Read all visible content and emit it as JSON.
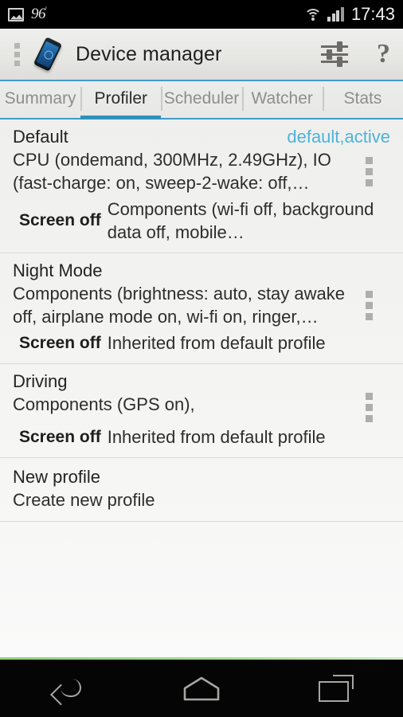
{
  "statusbar": {
    "gallery_icon": "gallery-icon",
    "battery_text": "96",
    "battery_mark": "'",
    "wifi_icon": "wifi-icon",
    "signal_icon": "signal-bars-icon",
    "time": "17:43"
  },
  "actionbar": {
    "overflow_icon": "grid-dots-icon",
    "app_icon": "device-phone-icon",
    "title": "Device manager",
    "settings_icon": "sliders-icon",
    "help_icon": "question-mark-icon",
    "help_label": "?"
  },
  "tabs": [
    {
      "label": "Summary",
      "active": false
    },
    {
      "label": "Profiler",
      "active": true
    },
    {
      "label": "Scheduler",
      "active": false
    },
    {
      "label": "Watcher",
      "active": false
    },
    {
      "label": "Stats",
      "active": false
    }
  ],
  "colors": {
    "accent_blue": "#2f92bc",
    "state_blue": "#4eb3d8",
    "divider": "#dadad8",
    "green_line": "#8fd07a"
  },
  "profiles": [
    {
      "name": "Default",
      "state": "default,active",
      "description": "CPU (ondemand, 300MHz, 2.49GHz), IO (fast-charge: on, sweep-2-wake: off,…",
      "screen_off_label": "Screen off",
      "screen_off_text": "Components (wi-fi off, background data off, mobile…",
      "menu_icon": "overflow-menu-icon"
    },
    {
      "name": "Night Mode",
      "state": "",
      "description": "Components (brightness: auto, stay awake off, airplane mode on, wi-fi on, ringer,…",
      "screen_off_label": "Screen off",
      "screen_off_text": "Inherited from default profile",
      "menu_icon": "overflow-menu-icon"
    },
    {
      "name": "Driving",
      "state": "",
      "description": "Components (GPS on),",
      "screen_off_label": "Screen off",
      "screen_off_text": "Inherited from default profile",
      "menu_icon": "overflow-menu-icon"
    }
  ],
  "new_profile": {
    "title": "New profile",
    "description": "Create new profile"
  },
  "navbar": {
    "back_icon": "back-arrow-icon",
    "home_icon": "home-icon",
    "recents_icon": "recent-apps-icon"
  }
}
